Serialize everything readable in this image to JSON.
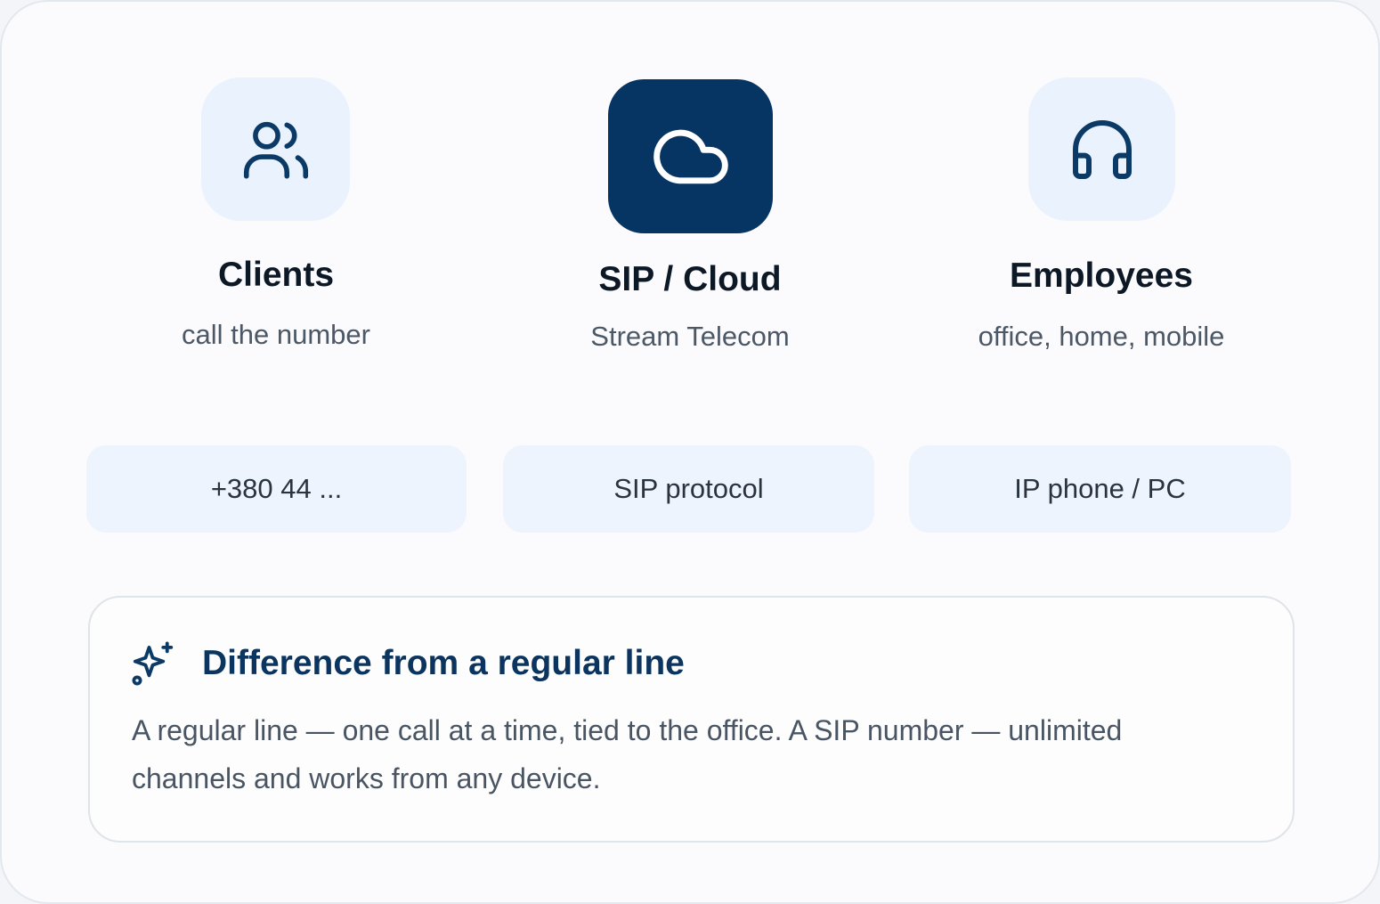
{
  "nodes": [
    {
      "title": "Clients",
      "subtitle": "call the number",
      "icon": "users-icon"
    },
    {
      "title": "SIP / Cloud",
      "subtitle": "Stream Telecom",
      "icon": "cloud-icon"
    },
    {
      "title": "Employees",
      "subtitle": "office, home, mobile",
      "icon": "headphones-icon"
    }
  ],
  "pills": [
    {
      "label": "+380 44 ..."
    },
    {
      "label": "SIP protocol"
    },
    {
      "label": "IP phone / PC"
    }
  ],
  "note": {
    "icon": "sparkles-icon",
    "title": "Difference from a regular line",
    "body": "A regular line — one call at a time, tied to the office. A SIP number — unlimited channels and works from any device."
  },
  "colors": {
    "accent_dark": "#063563",
    "tile_light": "#e9f2fd",
    "pill_bg": "#edf4fd",
    "icon_stroke": "#0b3a66"
  }
}
